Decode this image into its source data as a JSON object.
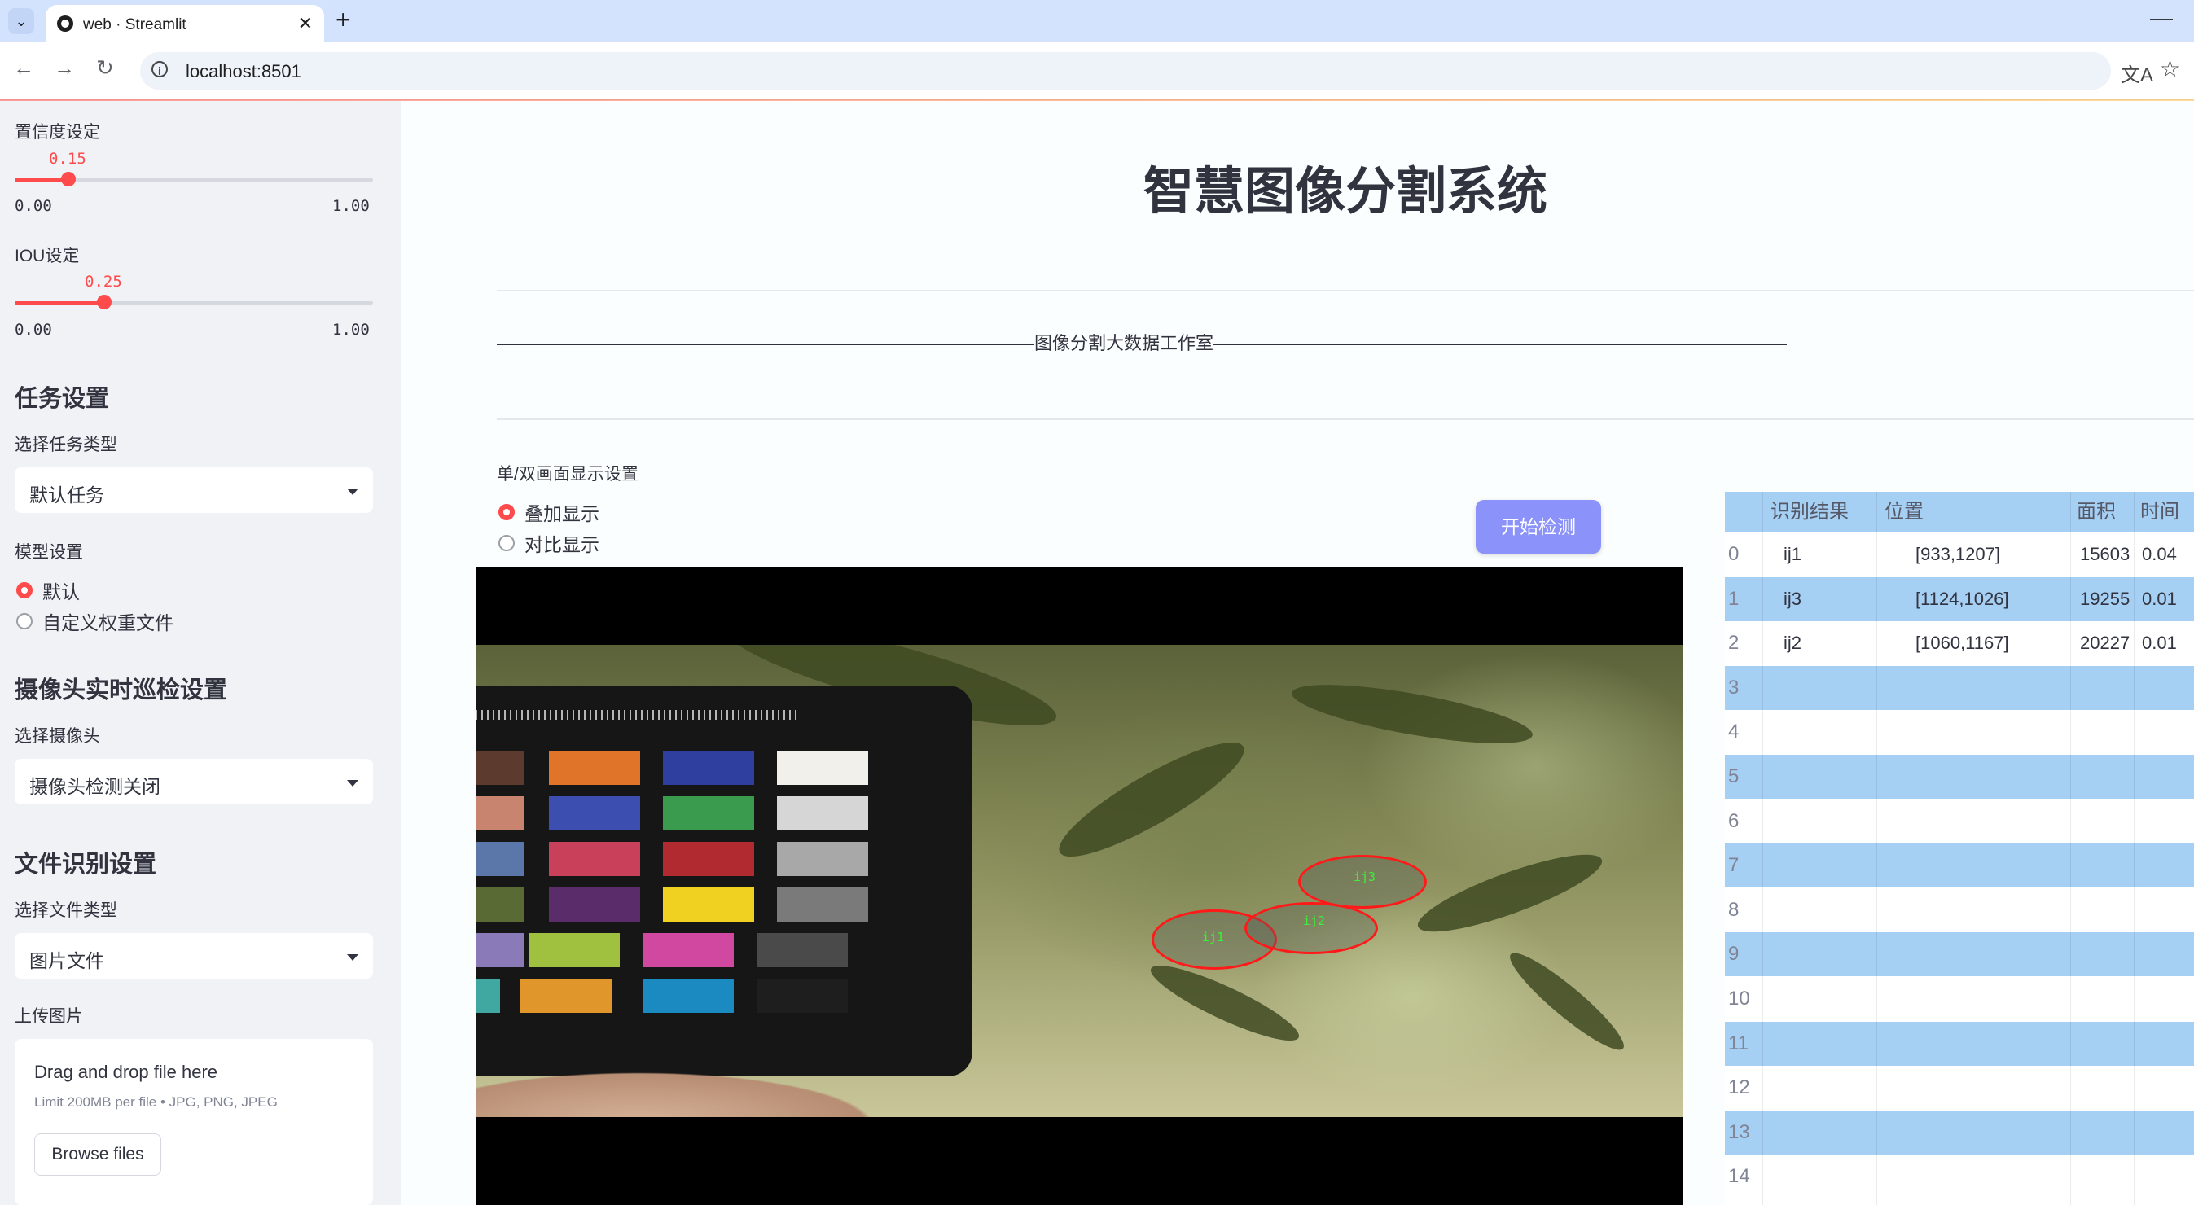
{
  "browser": {
    "tab_title": "web · Streamlit",
    "url": "localhost:8501"
  },
  "sidebar": {
    "confidence": {
      "label": "置信度设定",
      "value": 0.15,
      "value_text": "0.15",
      "min_text": "0.00",
      "max_text": "1.00"
    },
    "iou": {
      "label": "IOU设定",
      "value": 0.25,
      "value_text": "0.25",
      "min_text": "0.00",
      "max_text": "1.00"
    },
    "task_header": "任务设置",
    "task_type_label": "选择任务类型",
    "task_type_value": "默认任务",
    "model_label": "模型设置",
    "model_options": [
      "默认",
      "自定义权重文件"
    ],
    "camera_header": "摄像头实时巡检设置",
    "camera_label": "选择摄像头",
    "camera_value": "摄像头检测关闭",
    "file_header": "文件识别设置",
    "file_type_label": "选择文件类型",
    "file_type_value": "图片文件",
    "upload_label": "上传图片",
    "upload_title": "Drag and drop file here",
    "upload_limit": "Limit 200MB per file • JPG, PNG, JPEG",
    "browse_label": "Browse files"
  },
  "main": {
    "title": "智慧图像分割系统",
    "subtitle": "——————————————————————————————图像分割大数据工作室————————————————————————————————",
    "display_label": "单/双画面显示设置",
    "display_options": [
      "叠加显示",
      "对比显示"
    ],
    "start_button": "开始检测",
    "detections": [
      "ij1",
      "ij2",
      "ij3"
    ]
  },
  "table": {
    "headers": [
      "识别结果",
      "位置",
      "面积",
      "时间"
    ],
    "rows": [
      {
        "index": "0",
        "result": "ij1",
        "position": "[933,1207]",
        "area": "15603",
        "time": "0.04"
      },
      {
        "index": "1",
        "result": "ij3",
        "position": "[1124,1026]",
        "area": "19255",
        "time": "0.01"
      },
      {
        "index": "2",
        "result": "ij2",
        "position": "[1060,1167]",
        "area": "20227",
        "time": "0.01"
      },
      {
        "index": "3"
      },
      {
        "index": "4"
      },
      {
        "index": "5"
      },
      {
        "index": "6"
      },
      {
        "index": "7"
      },
      {
        "index": "8"
      },
      {
        "index": "9"
      },
      {
        "index": "10"
      },
      {
        "index": "11"
      },
      {
        "index": "12"
      },
      {
        "index": "13"
      },
      {
        "index": "14"
      }
    ]
  },
  "colors": {
    "accent": "#ff4b4b",
    "button": "#8b92f9",
    "table_stripe": "#a6cff4",
    "sidebar_bg": "#f0f2f6"
  }
}
